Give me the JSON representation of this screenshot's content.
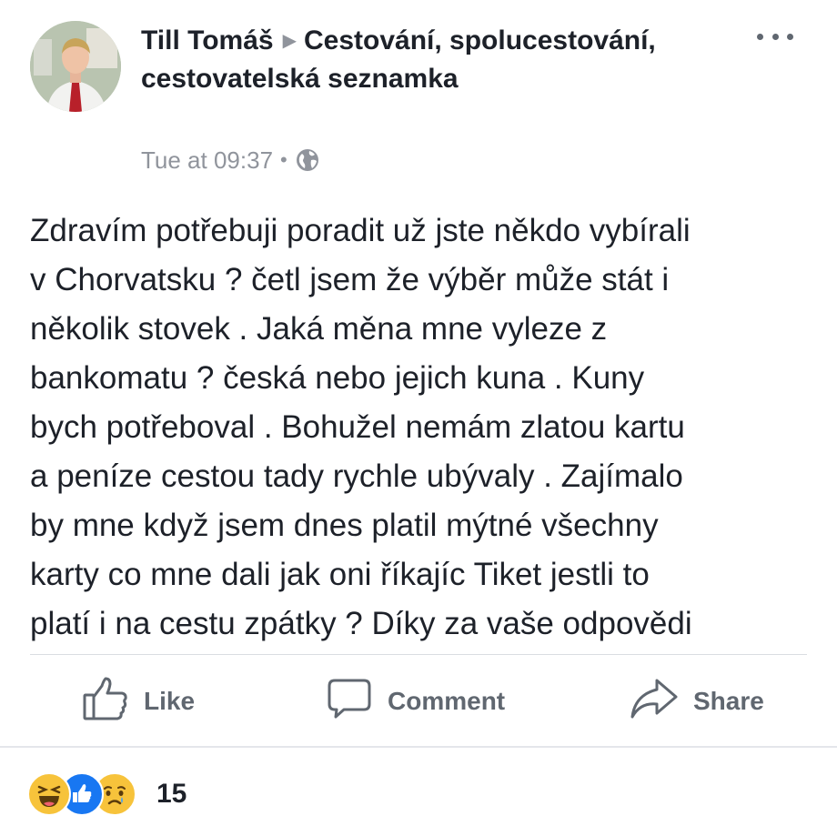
{
  "post": {
    "author": "Till Tomáš",
    "group": "Cestování, spolucestování, cestovatelská seznamka",
    "timestamp": "Tue at 09:37",
    "separator": "•",
    "privacy_icon": "globe-icon",
    "menu_icon": "more-options-icon",
    "text_lines": [
      "Zdravím potřebuji poradit už jste někdo vybírali",
      "v Chorvatsku ? četl jsem že výběr může stát i",
      "několik stovek . Jaká měna mne vyleze z",
      "bankomatu ? česká nebo jejich kuna . Kuny",
      "bych potřeboval . Bohužel nemám zlatou kartu",
      "a peníze cestou tady rychle ubývaly . Zajímalo",
      "by mne když jsem dnes platil mýtné všechny",
      "karty co mne dali jak oni říkajíc Tiket jestli to",
      "platí i na cestu zpátky ? Díky za vaše odpovědi"
    ]
  },
  "actions": {
    "like": "Like",
    "comment": "Comment",
    "share": "Share"
  },
  "reactions": {
    "icons": [
      "haha-icon",
      "like-icon",
      "sad-icon"
    ],
    "count": "15"
  },
  "colors": {
    "text": "#1d2129",
    "secondary": "#90949c",
    "action": "#606770",
    "like_blue": "#1877f2",
    "emoji_yellow": "#f7c33b"
  }
}
